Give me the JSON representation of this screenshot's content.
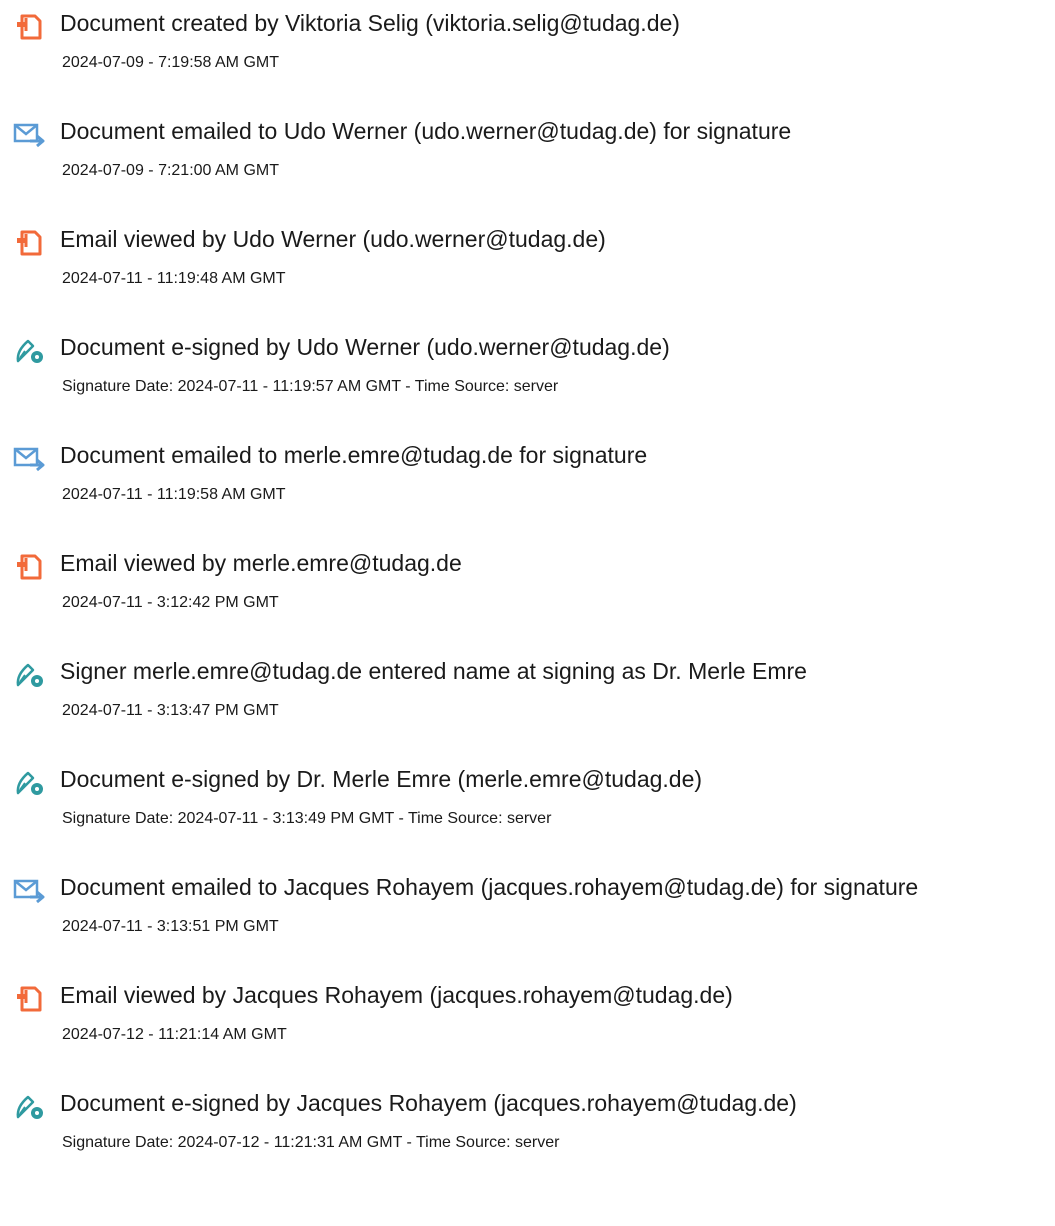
{
  "colors": {
    "created_icon": "#f26a3a",
    "email_icon": "#5b9bd5",
    "sign_icon": "#2f9aa0",
    "text": "#1a1a1a"
  },
  "events": [
    {
      "icon": "document-icon",
      "title": "Document created by Viktoria Selig (viktoria.selig@tudag.de)",
      "time": "2024-07-09 - 7:19:58 AM GMT"
    },
    {
      "icon": "email-icon",
      "title": "Document emailed to Udo Werner (udo.werner@tudag.de) for signature",
      "time": "2024-07-09 - 7:21:00 AM GMT"
    },
    {
      "icon": "document-icon",
      "title": "Email viewed by Udo Werner (udo.werner@tudag.de)",
      "time": "2024-07-11 - 11:19:48 AM GMT"
    },
    {
      "icon": "esign-icon",
      "title": "Document e-signed by Udo Werner (udo.werner@tudag.de)",
      "time": "Signature Date: 2024-07-11 - 11:19:57 AM GMT - Time Source: server"
    },
    {
      "icon": "email-icon",
      "title": "Document emailed to merle.emre@tudag.de for signature",
      "time": "2024-07-11 - 11:19:58 AM GMT"
    },
    {
      "icon": "document-icon",
      "title": "Email viewed by merle.emre@tudag.de",
      "time": "2024-07-11 - 3:12:42 PM GMT"
    },
    {
      "icon": "esign-icon",
      "title": "Signer merle.emre@tudag.de entered name at signing as Dr. Merle Emre",
      "time": "2024-07-11 - 3:13:47 PM GMT"
    },
    {
      "icon": "esign-icon",
      "title": "Document e-signed by Dr. Merle Emre (merle.emre@tudag.de)",
      "time": "Signature Date: 2024-07-11 - 3:13:49 PM GMT - Time Source: server"
    },
    {
      "icon": "email-icon",
      "title": "Document emailed to Jacques Rohayem (jacques.rohayem@tudag.de) for signature",
      "time": "2024-07-11 - 3:13:51 PM GMT"
    },
    {
      "icon": "document-icon",
      "title": "Email viewed by Jacques Rohayem (jacques.rohayem@tudag.de)",
      "time": "2024-07-12 - 11:21:14 AM GMT"
    },
    {
      "icon": "esign-icon",
      "title": "Document e-signed by Jacques Rohayem (jacques.rohayem@tudag.de)",
      "time": "Signature Date: 2024-07-12 - 11:21:31 AM GMT - Time Source: server"
    }
  ]
}
